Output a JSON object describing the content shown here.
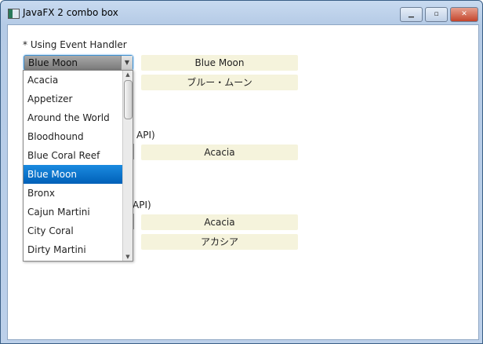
{
  "window": {
    "title": "JavaFX 2 combo box",
    "controls": [
      "minimize",
      "maximize",
      "close"
    ]
  },
  "section1": {
    "heading": "* Using Event Handler",
    "combo_value": "Blue Moon",
    "output1": "Blue Moon",
    "output2": "ブルー・ムーン"
  },
  "section2": {
    "heading_fragment": "API)",
    "output1": "Acacia"
  },
  "section3": {
    "heading_fragment": "API)",
    "output1": "Acacia",
    "output2": "アカシア"
  },
  "dropdown": {
    "items": [
      "Acacia",
      "Appetizer",
      "Around the World",
      "Bloodhound",
      "Blue Coral Reef",
      "Blue Moon",
      "Bronx",
      "Cajun Martini",
      "City Coral",
      "Dirty Martini"
    ],
    "selected": "Blue Moon"
  },
  "colors": {
    "selection": "#0a74cc",
    "output_bg": "#f5f3dc"
  }
}
